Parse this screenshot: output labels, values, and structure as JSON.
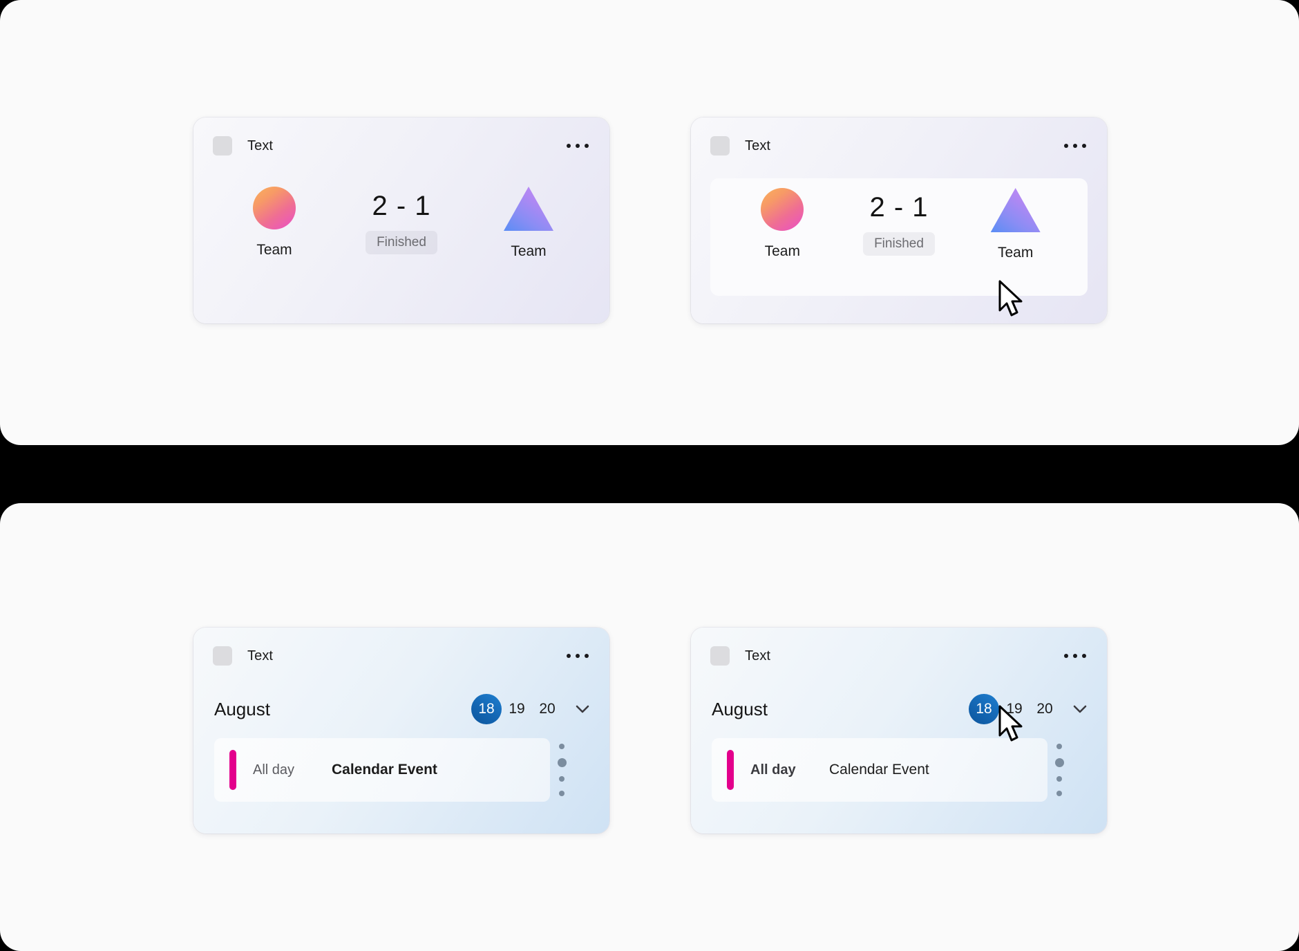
{
  "page": {
    "background_color": "#000000",
    "panel_color": "#fafafa"
  },
  "cards": [
    {
      "id": "score-card-rest",
      "state": "rest",
      "type": "score",
      "header": {
        "icon": "placeholder-square-icon",
        "label": "Text",
        "menu_icon": "ellipsis-icon"
      },
      "home_team": {
        "name": "Team",
        "mark": "circle-gradient-icon"
      },
      "away_team": {
        "name": "Team",
        "mark": "triangle-gradient-icon"
      },
      "score": "2 - 1",
      "status": "Finished"
    },
    {
      "id": "score-card-hover",
      "state": "hover",
      "type": "score",
      "header": {
        "icon": "placeholder-square-icon",
        "label": "Text",
        "menu_icon": "ellipsis-icon"
      },
      "home_team": {
        "name": "Team",
        "mark": "circle-gradient-icon"
      },
      "away_team": {
        "name": "Team",
        "mark": "triangle-gradient-icon"
      },
      "score": "2 - 1",
      "status": "Finished"
    },
    {
      "id": "calendar-card-rest",
      "state": "rest",
      "type": "calendar",
      "header": {
        "icon": "placeholder-square-icon",
        "label": "Text",
        "menu_icon": "ellipsis-icon"
      },
      "month": "August",
      "days": [
        {
          "label": "18",
          "selected": true
        },
        {
          "label": "19",
          "selected": false
        },
        {
          "label": "20",
          "selected": false
        }
      ],
      "expand_icon": "chevron-down-icon",
      "event": {
        "time": "All day",
        "title": "Calendar Event",
        "accent_color": "#e3008c"
      },
      "pager_dots": [
        "small",
        "large",
        "small",
        "small"
      ]
    },
    {
      "id": "calendar-card-hover",
      "state": "hover",
      "type": "calendar",
      "header": {
        "icon": "placeholder-square-icon",
        "label": "Text",
        "menu_icon": "ellipsis-icon"
      },
      "month": "August",
      "days": [
        {
          "label": "18",
          "selected": true
        },
        {
          "label": "19",
          "selected": false
        },
        {
          "label": "20",
          "selected": false
        }
      ],
      "expand_icon": "chevron-down-icon",
      "event": {
        "time": "All day",
        "title": "Calendar Event",
        "accent_color": "#e3008c"
      },
      "pager_dots": [
        "small",
        "large",
        "small",
        "small"
      ]
    }
  ],
  "colors": {
    "calendar_accent": "#e3008c",
    "today_chip": "#1467b4",
    "circle_gradient_from": "#f9b15c",
    "circle_gradient_to": "#ea4fc8",
    "triangle_gradient_from": "#c58df5",
    "triangle_gradient_to": "#5a8df5",
    "status_text": "#6b6b70"
  },
  "cursors": [
    {
      "name": "pointer-arrow-score-card"
    },
    {
      "name": "pointer-arrow-calendar-card"
    }
  ]
}
